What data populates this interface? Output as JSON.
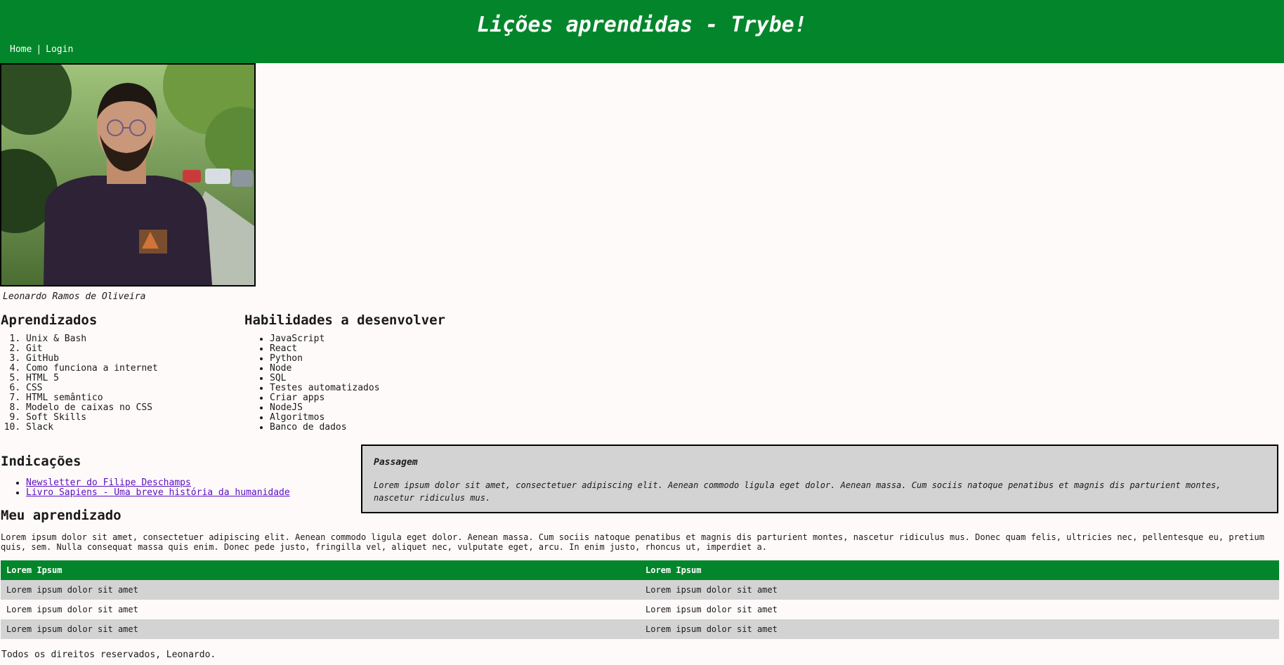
{
  "header": {
    "title": "Lições aprendidas - Trybe!",
    "nav": [
      "Home",
      "Login"
    ]
  },
  "profile": {
    "caption": "Leonardo Ramos de Oliveira"
  },
  "aprendizados": {
    "title": "Aprendizados",
    "items": [
      "Unix & Bash",
      "Git",
      "GitHub",
      "Como funciona a internet",
      "HTML 5",
      "CSS",
      "HTML semântico",
      "Modelo de caixas no CSS",
      "Soft Skills",
      "Slack"
    ]
  },
  "habilidades": {
    "title": "Habilidades a desenvolver",
    "items": [
      "JavaScript",
      "React",
      "Python",
      "Node",
      "SQL",
      "Testes automatizados",
      "Criar apps",
      "NodeJS",
      "Algoritmos",
      "Banco de dados"
    ]
  },
  "indicacoes": {
    "title": "Indicações",
    "links": [
      "Newsletter do Filipe Deschamps",
      "Livro Sapiens - Uma breve história da humanidade"
    ]
  },
  "passagem": {
    "title": "Passagem",
    "text": "Lorem ipsum dolor sit amet, consectetuer adipiscing elit. Aenean commodo ligula eget dolor. Aenean massa. Cum sociis natoque penatibus et magnis dis parturient montes, nascetur ridiculus mus."
  },
  "meu_aprendizado": {
    "title": "Meu aprendizado",
    "text": "Lorem ipsum dolor sit amet, consectetuer adipiscing elit. Aenean commodo ligula eget dolor. Aenean massa. Cum sociis natoque penatibus et magnis dis parturient montes, nascetur ridiculus mus. Donec quam felis, ultricies nec, pellentesque eu, pretium quis, sem. Nulla consequat massa quis enim. Donec pede justo, fringilla vel, aliquet nec, vulputate eget, arcu. In enim justo, rhoncus ut, imperdiet a."
  },
  "table": {
    "headers": [
      "Lorem Ipsum",
      "Lorem Ipsum"
    ],
    "rows": [
      [
        "Lorem ipsum dolor sit amet",
        "Lorem ipsum dolor sit amet"
      ],
      [
        "Lorem ipsum dolor sit amet",
        "Lorem ipsum dolor sit amet"
      ],
      [
        "Lorem ipsum dolor sit amet",
        "Lorem ipsum dolor sit amet"
      ]
    ]
  },
  "footer": {
    "text": "Todos os direitos reservados, Leonardo."
  },
  "colors": {
    "brand_green": "#03862b",
    "row_gray": "#d3d3d3",
    "link_purple": "#5a0fbf"
  }
}
